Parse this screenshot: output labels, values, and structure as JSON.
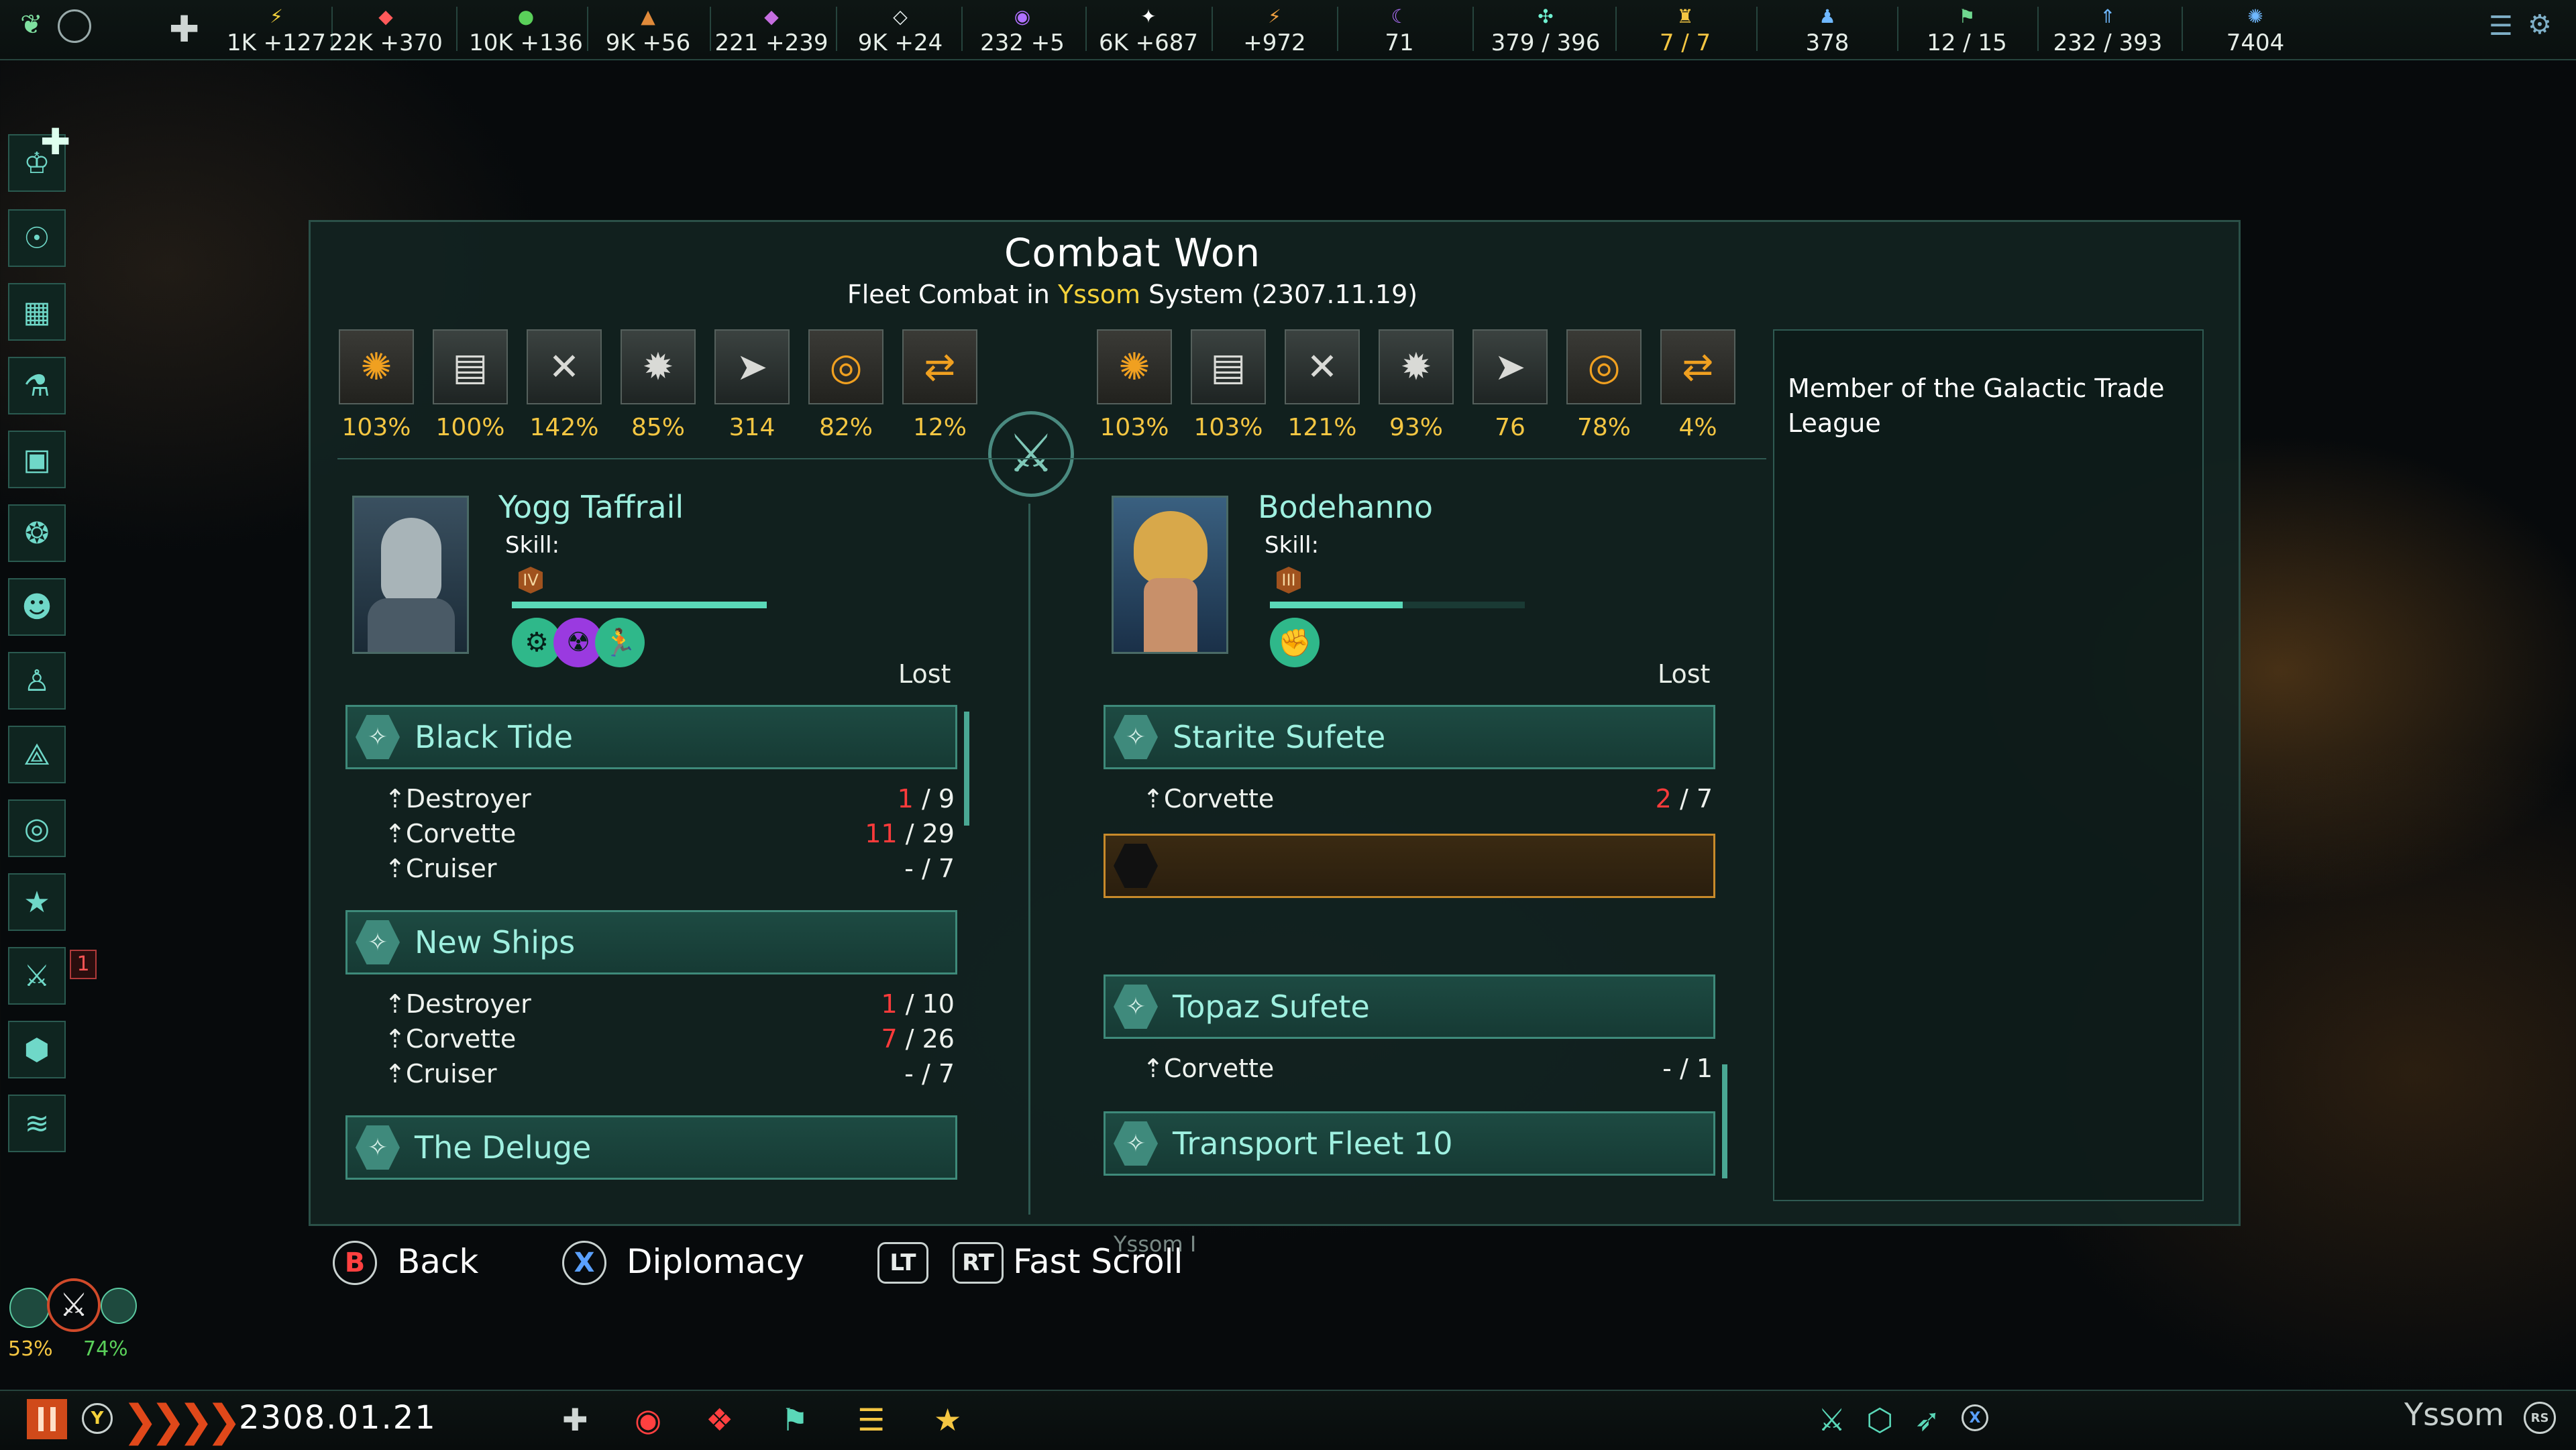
{
  "top_resources": [
    {
      "icon": "energy-icon",
      "glyph": "⚡",
      "color": "#f2d23c",
      "value": "1K +127"
    },
    {
      "icon": "minerals-icon",
      "glyph": "◆",
      "color": "#ff5a5a",
      "value": "22K +370"
    },
    {
      "icon": "food-icon",
      "glyph": "●",
      "color": "#5ad05a",
      "value": "10K +136"
    },
    {
      "icon": "consumer-goods-icon",
      "glyph": "▲",
      "color": "#e08a3a",
      "value": "9K +56"
    },
    {
      "icon": "alloys-icon",
      "glyph": "◆",
      "color": "#c56ee0",
      "value": "221 +239"
    },
    {
      "icon": "trade-icon",
      "glyph": "◇",
      "color": "#e8f0f0",
      "value": "9K +24"
    },
    {
      "icon": "influence-icon",
      "glyph": "◉",
      "color": "#b070ff",
      "value": "232 +5"
    },
    {
      "icon": "unity-icon",
      "glyph": "✦",
      "color": "#ffffff",
      "value": "6K +687"
    },
    {
      "icon": "research-icon",
      "glyph": "⚡",
      "color": "#f0a040",
      "value": "+972"
    },
    {
      "icon": "special-resource-icon",
      "glyph": "☾",
      "color": "#b070ff",
      "value": "71"
    },
    {
      "icon": "fleet-size-icon",
      "glyph": "✣",
      "color": "#6ff0d0",
      "value": "379 / 396"
    },
    {
      "icon": "starbase-icon",
      "glyph": "♜",
      "color": "#f4c642",
      "value": "7 / 7",
      "highlight": true
    },
    {
      "icon": "pops-icon",
      "glyph": "♟",
      "color": "#6fb8ff",
      "value": "378"
    },
    {
      "icon": "envoy-icon",
      "glyph": "⚑",
      "color": "#6fd88f",
      "value": "12 / 15"
    },
    {
      "icon": "naval-capacity-icon",
      "glyph": "⇑",
      "color": "#6fb8ff",
      "value": "232 / 393"
    },
    {
      "icon": "empire-score-icon",
      "glyph": "✺",
      "color": "#6fb8ff",
      "value": "7404"
    }
  ],
  "panel": {
    "title": "Combat Won",
    "subtitle_pre": "Fleet Combat in ",
    "subtitle_system": "Yssom",
    "subtitle_post": " System (2307.11.19)",
    "side_text": "Member of the Galactic Trade League",
    "lost_label": "Lost",
    "skill_label": "Skill:"
  },
  "left": {
    "stats": [
      "103%",
      "100%",
      "142%",
      "85%",
      "314",
      "82%",
      "12%"
    ],
    "commander": "Yogg Taffrail",
    "rank": "IV",
    "fleets": [
      {
        "name": "Black Tide",
        "ships": [
          {
            "type": "Destroyer",
            "lost": "1",
            "total": "/ 9"
          },
          {
            "type": "Corvette",
            "lost": "11",
            "total": "/ 29"
          },
          {
            "type": "Cruiser",
            "lost": "-",
            "total": "/ 7"
          }
        ]
      },
      {
        "name": "New Ships",
        "ships": [
          {
            "type": "Destroyer",
            "lost": "1",
            "total": "/ 10"
          },
          {
            "type": "Corvette",
            "lost": "7",
            "total": "/ 26"
          },
          {
            "type": "Cruiser",
            "lost": "-",
            "total": "/ 7"
          }
        ]
      },
      {
        "name": "The Deluge",
        "ships": []
      }
    ]
  },
  "right": {
    "stats": [
      "103%",
      "103%",
      "121%",
      "93%",
      "76",
      "78%",
      "4%"
    ],
    "commander": "Bodehanno",
    "rank": "III",
    "fleets": [
      {
        "name": "Starite Sufete",
        "ships": [
          {
            "type": "Corvette",
            "lost": "2",
            "total": "/ 7"
          }
        ]
      },
      {
        "name": "Topaz Sufete",
        "ships": [
          {
            "type": "Corvette",
            "lost": "-",
            "total": "/ 1"
          }
        ]
      },
      {
        "name": "Transport Fleet 10",
        "ships": []
      }
    ]
  },
  "buttons": {
    "back_key": "B",
    "back": "Back",
    "diplomacy_key": "X",
    "diplomacy": "Diplomacy",
    "lt": "LT",
    "rt": "RT",
    "fast_scroll": "Fast Scroll"
  },
  "bottom": {
    "date": "2308.01.21",
    "pause_key": "Y",
    "location": "Yssom",
    "rs_key": "RS",
    "x_key": "X",
    "war_badge": "1",
    "war_left_pct": "53%",
    "war_right_pct": "74%"
  },
  "map_labels": {
    "yssom_i": "Yssom I"
  }
}
